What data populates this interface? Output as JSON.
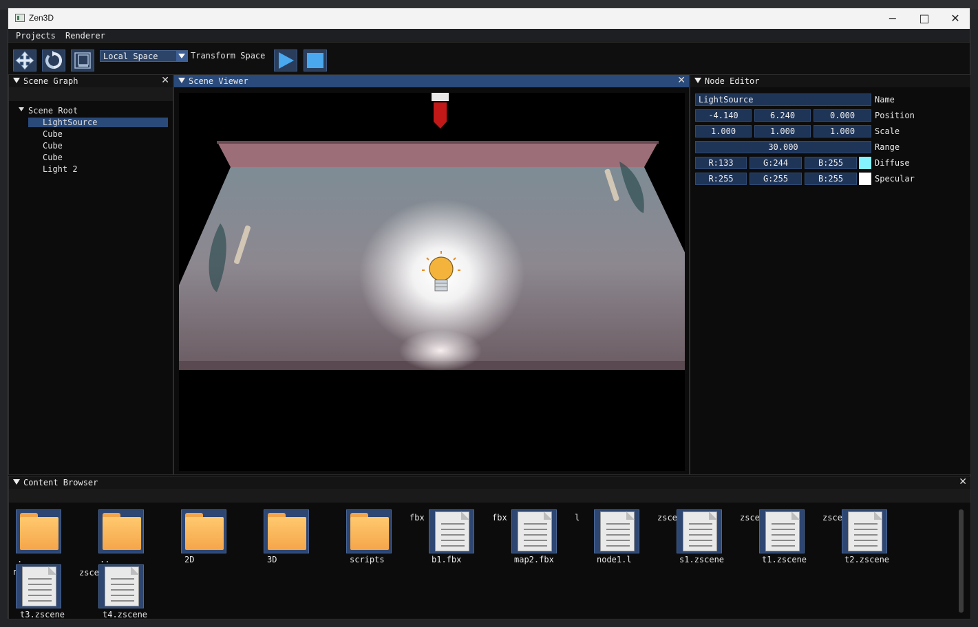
{
  "window": {
    "title": "Zen3D"
  },
  "menu": [
    "Projects",
    "Renderer"
  ],
  "toolbar": {
    "space_select": "Local Space",
    "transform_label": "Transform Space"
  },
  "scene_graph": {
    "title": "Scene Graph",
    "root": "Scene Root",
    "items": [
      "LightSource",
      "Cube",
      "Cube",
      "Cube",
      "Light 2"
    ],
    "selected": "LightSource"
  },
  "scene_viewer": {
    "title": "Scene Viewer"
  },
  "node_editor": {
    "title": "Node Editor",
    "name_value": "LightSource",
    "name_label": "Name",
    "position": [
      "-4.140",
      "6.240",
      "0.000"
    ],
    "position_label": "Position",
    "scale": [
      "1.000",
      "1.000",
      "1.000"
    ],
    "scale_label": "Scale",
    "range": "30.000",
    "range_label": "Range",
    "diffuse": [
      "R:133",
      "G:244",
      "B:255"
    ],
    "diffuse_label": "Diffuse",
    "diffuse_color": "#85f4ff",
    "specular": [
      "R:255",
      "G:255",
      "B:255"
    ],
    "specular_label": "Specular",
    "specular_color": "#ffffff"
  },
  "content_browser": {
    "title": "Content Browser",
    "folders": [
      ".",
      "..",
      "2D",
      "3D",
      "scripts"
    ],
    "files": [
      {
        "name": "b1.fbx",
        "ext": "fbx"
      },
      {
        "name": "map2.fbx",
        "ext": "fbx"
      },
      {
        "name": "node1.l",
        "ext": "l"
      },
      {
        "name": "s1.zscene",
        "ext": "zscene"
      },
      {
        "name": "t1.zscene",
        "ext": "zscene"
      },
      {
        "name": "t2.zscene",
        "ext": "zscene"
      },
      {
        "name": "t3.zscene",
        "ext": "ne"
      },
      {
        "name": "t4.zscene",
        "ext": "zscene"
      }
    ]
  }
}
